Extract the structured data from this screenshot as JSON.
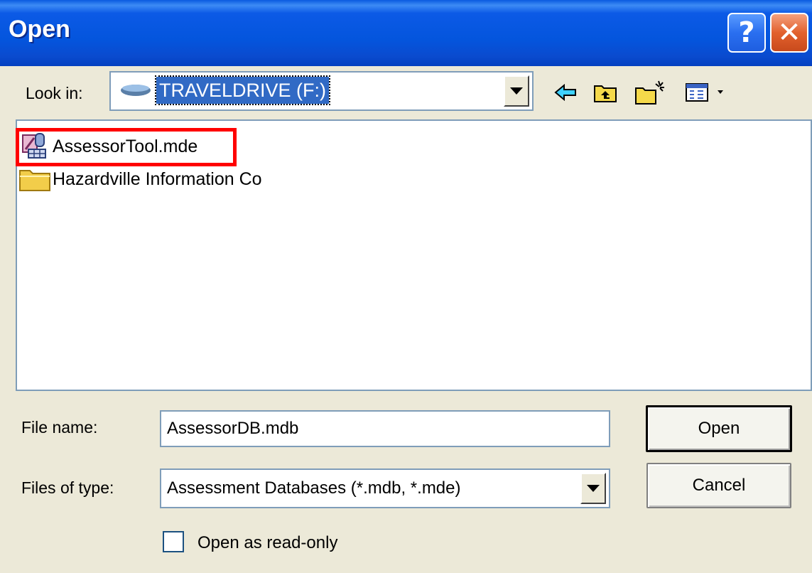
{
  "window": {
    "title": "Open"
  },
  "title_buttons": {
    "help": "?",
    "close": "✕"
  },
  "look_in": {
    "label": "Look in:",
    "value": "TRAVELDRIVE (F:)"
  },
  "toolbar": [
    {
      "name": "back-icon"
    },
    {
      "name": "up-folder-icon"
    },
    {
      "name": "new-folder-icon"
    },
    {
      "name": "view-menu-icon"
    }
  ],
  "files": [
    {
      "name": "AssessorTool.mde",
      "icon": "access-database-icon",
      "highlighted": true
    },
    {
      "name": "Hazardville Information Co",
      "icon": "folder-icon",
      "highlighted": false
    }
  ],
  "file_name": {
    "label": "File name:",
    "value": "AssessorDB.mdb"
  },
  "files_of_type": {
    "label": "Files of type:",
    "value": "Assessment Databases (*.mdb, *.mde)"
  },
  "buttons": {
    "open": "Open",
    "cancel": "Cancel"
  },
  "read_only": {
    "label": "Open as read-only",
    "checked": false
  },
  "colors": {
    "title_bar": "#0455dd",
    "dialog_bg": "#ece9d8",
    "selection": "#316ac5",
    "highlight_box": "#ff0000"
  }
}
